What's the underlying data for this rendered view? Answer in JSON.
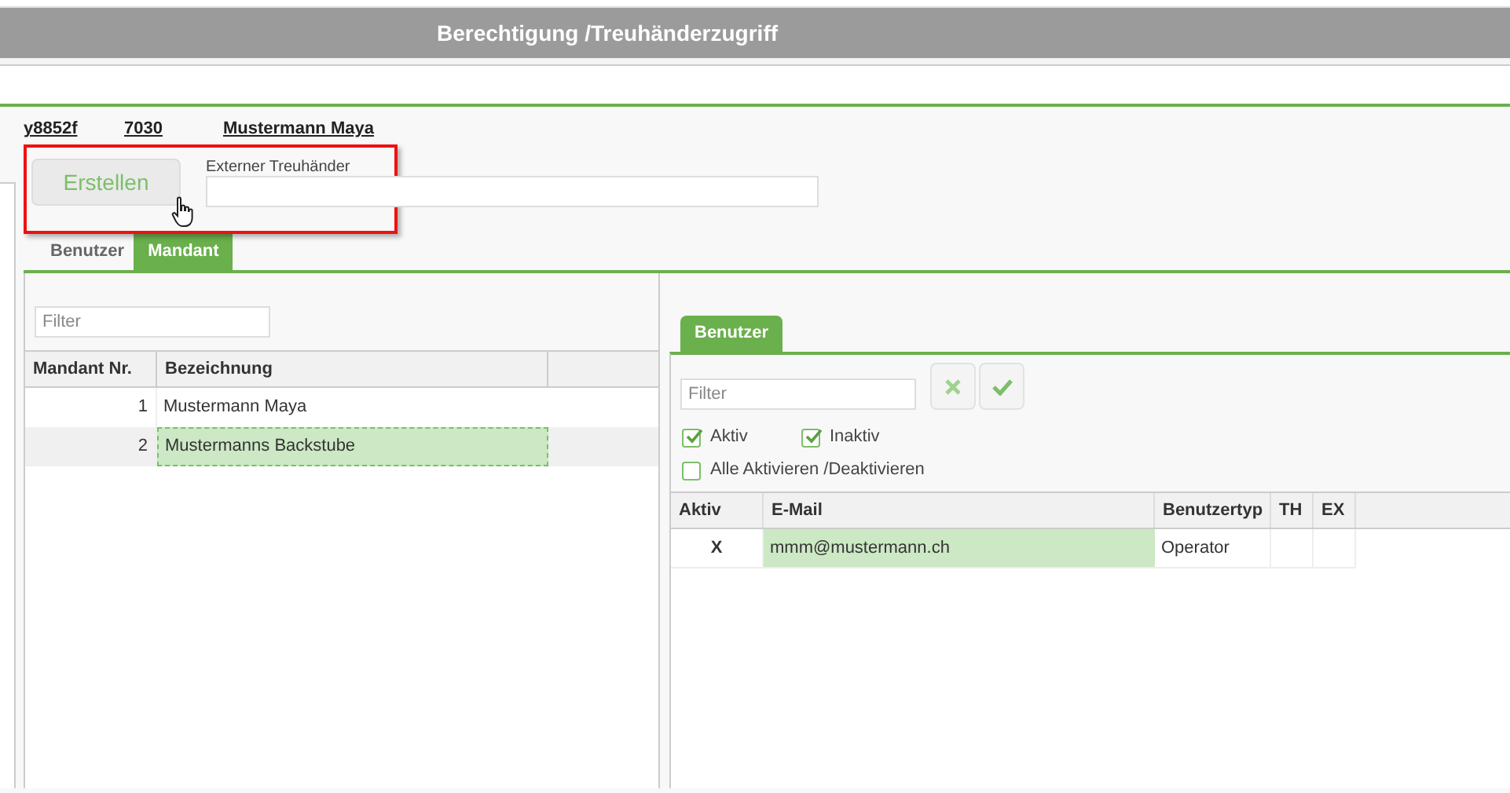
{
  "window": {
    "title": "Berechtigung /Treuhänderzugriff"
  },
  "header_links": [
    "y8852f",
    "7030",
    "Mustermann Maya"
  ],
  "create_button": {
    "label": "Erstellen"
  },
  "external_trustee": {
    "label": "Externer Treuhänder"
  },
  "tabs": [
    {
      "label": "Benutzer",
      "selected": false
    },
    {
      "label": "Mandant",
      "selected": true
    }
  ],
  "mandant_panel": {
    "filter": {
      "placeholder": "Filter"
    },
    "table": {
      "columns": [
        "Mandant Nr.",
        "Bezeichnung"
      ],
      "rows": [
        {
          "number": "1",
          "name": "Mustermann Maya",
          "selected": false
        },
        {
          "number": "2",
          "name": "Mustermanns Backstube",
          "selected": true
        }
      ]
    }
  },
  "user_panel": {
    "tabs": [
      {
        "label": "Benutzer",
        "selected": true
      }
    ],
    "filter": {
      "placeholder": "Filter"
    },
    "buttons": [
      {
        "kind": "cancel"
      },
      {
        "kind": "confirm"
      }
    ],
    "checkboxes": [
      {
        "label": "Aktiv",
        "checked": true
      },
      {
        "label": "Inaktiv",
        "checked": true
      },
      {
        "label": "Alle Aktivieren /Deaktivieren",
        "checked": false
      }
    ],
    "table": {
      "columns": [
        "Aktiv",
        "E-Mail",
        "Benutzertyp",
        "TH",
        "EX"
      ],
      "rows": [
        {
          "aktiv": "X",
          "email": "mmm@mustermann.ch",
          "user_type": "Operator",
          "email_selected": true
        }
      ]
    }
  }
}
